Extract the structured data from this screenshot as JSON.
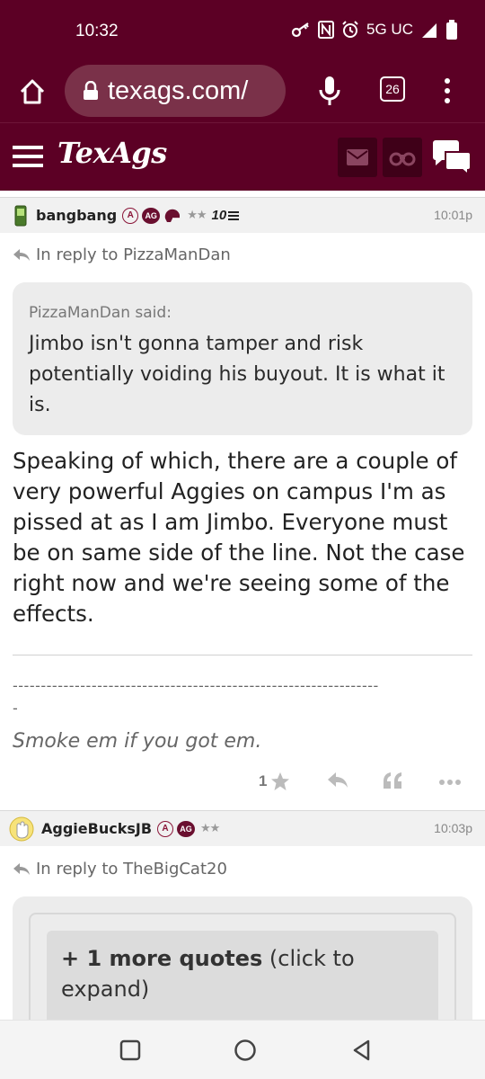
{
  "status_bar": {
    "time": "10:32",
    "network": "5G UC"
  },
  "browser": {
    "url": "texags.com/",
    "tab_count": "26"
  },
  "site": {
    "logo": "TexAgs"
  },
  "posts": [
    {
      "author": "bangbang",
      "badges": [
        "A",
        "AG"
      ],
      "stars": "★★",
      "rank": "10",
      "time": "10:01p",
      "reply_to": "In reply to PizzaManDan",
      "quote_author": "PizzaManDan said:",
      "quote_text": "Jimbo isn't gonna tamper and risk potentially voiding his buyout. It is what it is.",
      "body": "Speaking of which, there are a couple of very powerful Aggies on campus I'm as pissed at as I am Jimbo. Everyone must be on same side of the line. Not the case right now and we're seeing some of the effects.",
      "signature_dashes": "-----------------------------------------------------------------",
      "signature_dash_tail": "-",
      "signature": "Smoke em if you got em.",
      "like_count": "1"
    },
    {
      "author": "AggieBucksJB",
      "badges": [
        "A",
        "AG"
      ],
      "stars": "★★",
      "time": "10:03p",
      "reply_to": "In reply to TheBigCat20",
      "more_quotes_bold": "+ 1 more quotes",
      "more_quotes_rest": " (click to expand)"
    }
  ],
  "colors": {
    "maroon": "#5c0025",
    "maroon_dark": "#3f0018",
    "url_pill": "#7a3149"
  }
}
